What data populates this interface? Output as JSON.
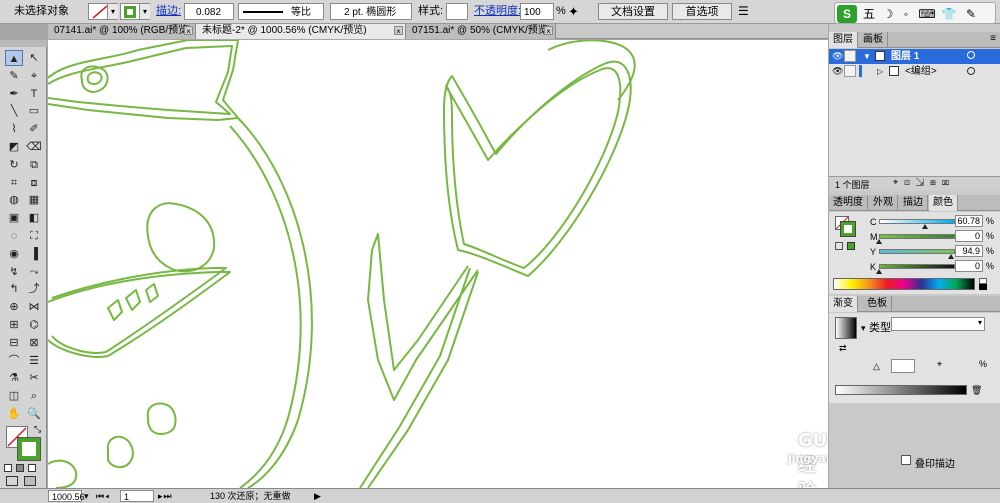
{
  "control_bar": {
    "selection_label": "未选择对象",
    "stroke_link": "描边:",
    "stroke_weight": "0.082",
    "stroke_profile": "等比",
    "brush_label": "2 pt. 椭圆形",
    "style_label": "样式:",
    "opacity_link": "不透明度:",
    "opacity_value": "100",
    "opacity_unit": "%",
    "doc_setup_button": "文档设置",
    "preferences_button": "首选项"
  },
  "document_tabs": [
    {
      "title": "07141.ai* @ 100% (RGB/预览)",
      "active": false
    },
    {
      "title": "未标题-2* @ 1000.56% (CMYK/预览)",
      "active": true
    },
    {
      "title": "07151.ai* @ 50% (CMYK/预览)",
      "active": false
    }
  ],
  "tools": [
    "▲",
    "↖",
    "✎",
    "⌖",
    "✒",
    "T",
    "╲",
    "▭",
    "⌇",
    "✐",
    "◩",
    "⌫",
    "↻",
    "⧉",
    "⌗",
    "⧈",
    "◍",
    "▦",
    "▣",
    "◧",
    "◌",
    "⛶",
    "◉",
    "▐",
    "↯",
    "⤳",
    "↰",
    "⤴",
    "⊕",
    "⋈",
    "⊞",
    "⌬",
    "⊟",
    "⊠",
    "⌒",
    "☰",
    "⚗",
    "✂",
    "◫",
    "⌕",
    "✋",
    "🔍"
  ],
  "layers_panel": {
    "tabs": [
      "图层",
      "画板"
    ],
    "layers": [
      {
        "name": "图层 1",
        "selected": true
      },
      {
        "name": "<编组>",
        "selected": false
      }
    ],
    "footer_count": "1 个图层"
  },
  "color_panel": {
    "tabs": [
      "透明度",
      "外观",
      "描边",
      "颜色"
    ],
    "channels": [
      {
        "label": "C",
        "value": "60.78",
        "unit": "%",
        "gradient": "#ffffff,#00aeef",
        "level": 0.6078
      },
      {
        "label": "M",
        "value": "0",
        "unit": "%",
        "gradient": "#7bbf4a,#3a7f3a",
        "level": 0
      },
      {
        "label": "Y",
        "value": "94.9",
        "unit": "%",
        "gradient": "#5cb8e8,#7dc44a",
        "level": 0.949
      },
      {
        "label": "K",
        "value": "0",
        "unit": "%",
        "gradient": "#6db33f,#111111",
        "level": 0
      }
    ],
    "stroke_color": "#6ab23a"
  },
  "gradient_panel": {
    "tabs": [
      "渐变",
      "色板"
    ],
    "type_label": "类型:",
    "opacity_unit": "%"
  },
  "status_bar": {
    "zoom": "1000.56",
    "artboard": "1",
    "history": "130 次还原；无重做"
  },
  "ime_bar": {
    "logo": "S",
    "mode": "五",
    "icons": [
      "☽",
      "◦",
      "⌨",
      "👕",
      "✎"
    ]
  },
  "watermark": {
    "text": "GU 经验",
    "sub": "jingyan.baidu.com",
    "extra": "叠印描边"
  }
}
